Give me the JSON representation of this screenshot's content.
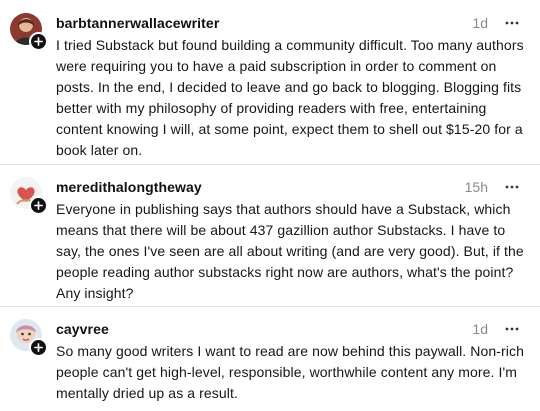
{
  "comments": [
    {
      "username": "barbtannerwallacewriter",
      "time": "1d",
      "text": "I tried Substack but found building a community difficult. Too many authors were requiring you to have a paid subscription in order to comment on posts. In the end, I decided to leave and go back to blogging. Blogging fits better with my philosophy of providing readers with free, entertaining content knowing I will, at some point, expect them to shell out $15-20 for a book later on."
    },
    {
      "username": "meredithalongtheway",
      "time": "15h",
      "text": "Everyone in publishing says that authors should have a Substack, which means that there will be about 437 gazillion author Substacks. I have to say, the ones I've seen are all about writing (and are very good). But, if the people reading author substacks right now are authors, what's the point? Any insight?"
    },
    {
      "username": "cayvree",
      "time": "1d",
      "text": "So many good writers I want to read are now behind this paywall. Non-rich people can't get high-level, responsible, worthwhile content any more. I'm mentally dried up as a result."
    }
  ],
  "icons": {
    "follow": "plus-icon",
    "more": "more-options-icon"
  }
}
